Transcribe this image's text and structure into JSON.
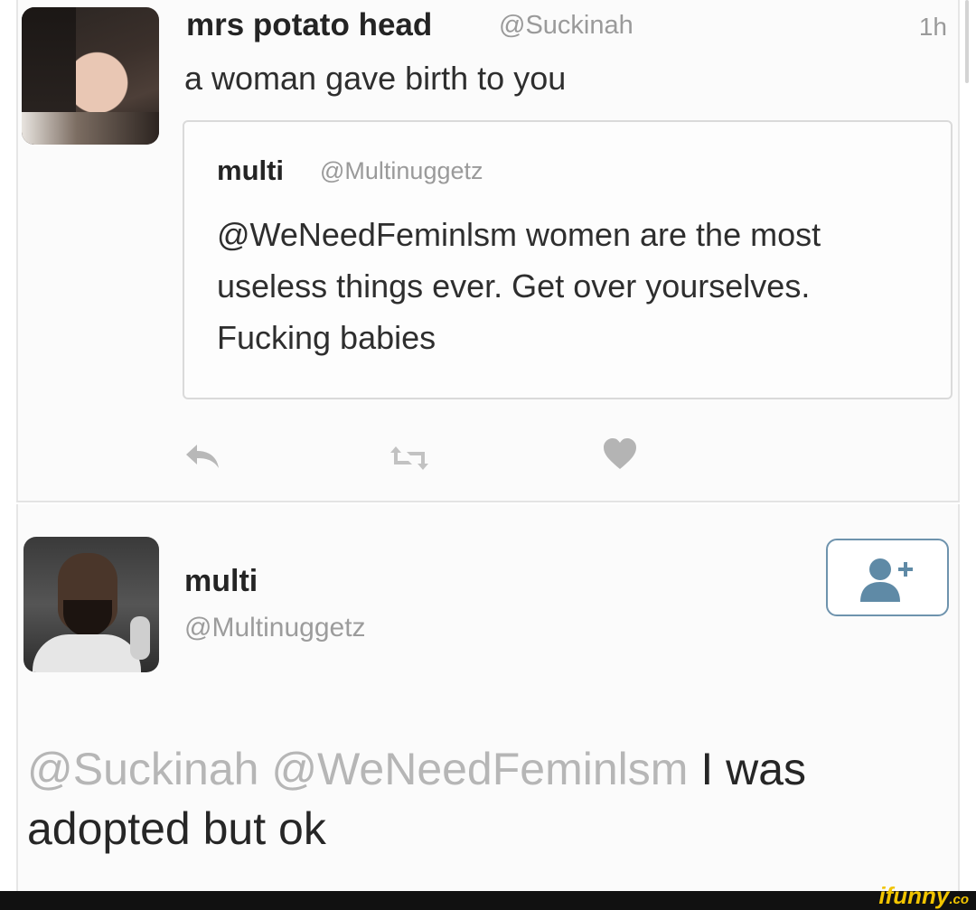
{
  "tweet": {
    "display_name": "mrs potato head",
    "handle": "@Suckinah",
    "time": "1h",
    "text": "a woman gave birth to you",
    "quoted": {
      "display_name": "multi",
      "handle": "@Multinuggetz",
      "text": "@WeNeedFeminlsm women are the most useless things ever. Get over yourselves. Fucking babies"
    },
    "actions": {
      "reply_icon": "reply-icon",
      "retweet_icon": "retweet-icon",
      "like_icon": "heart-icon"
    }
  },
  "reply": {
    "display_name": "multi",
    "handle": "@Multinuggetz",
    "follow_icon": "add-user-icon",
    "mention_1": "@Suckinah",
    "mention_2": "@WeNeedFeminlsm",
    "text": "I was adopted but ok"
  },
  "watermark": {
    "brand": "ifunny",
    "suffix": ".co"
  },
  "colors": {
    "handle_gray": "#9a9a9a",
    "action_gray": "#b8b8b8",
    "follow_border": "#6e93ad",
    "follow_icon": "#5f8aa6",
    "watermark_yellow": "#f1c400"
  }
}
